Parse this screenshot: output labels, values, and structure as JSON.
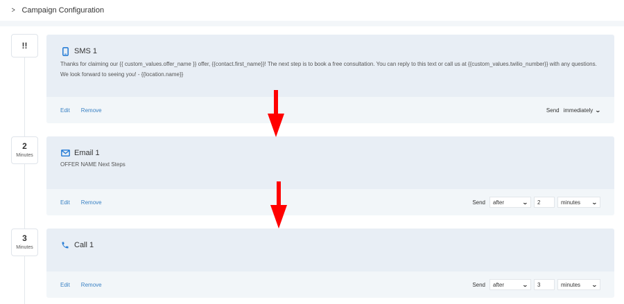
{
  "header": {
    "title": "Campaign Configuration"
  },
  "steps": [
    {
      "badge": {
        "value": "!!",
        "unit": ""
      },
      "title": "SMS 1",
      "text": "Thanks for claiming our {{ custom_values.offer_name }} offer, {{contact.first_name}}! The next step is to book a free consultation. You can reply to this text or call us at {{custom_values.twilio_number}} with any questions. We look forward to seeing you! - {{location.name}}",
      "edit_label": "Edit",
      "remove_label": "Remove",
      "send_label": "Send",
      "send_when": "immediately"
    },
    {
      "badge": {
        "value": "2",
        "unit": "Minutes"
      },
      "title": "Email 1",
      "text": "OFFER NAME Next Steps",
      "edit_label": "Edit",
      "remove_label": "Remove",
      "send_label": "Send",
      "send_when": "after",
      "delay_value": "2",
      "delay_unit": "minutes"
    },
    {
      "badge": {
        "value": "3",
        "unit": "Minutes"
      },
      "title": "Call 1",
      "text": "",
      "edit_label": "Edit",
      "remove_label": "Remove",
      "send_label": "Send",
      "send_when": "after",
      "delay_value": "3",
      "delay_unit": "minutes"
    }
  ],
  "colors": {
    "accent": "#2b7fd6",
    "link": "#3b82c4",
    "card_body": "#e8eef5",
    "card_footer": "#f2f6f9",
    "annotation_arrow": "#ff0000"
  },
  "icons": {
    "sms": "mobile-phone-icon",
    "email": "envelope-icon",
    "call": "phone-icon",
    "expand": "chevron-right-icon"
  }
}
